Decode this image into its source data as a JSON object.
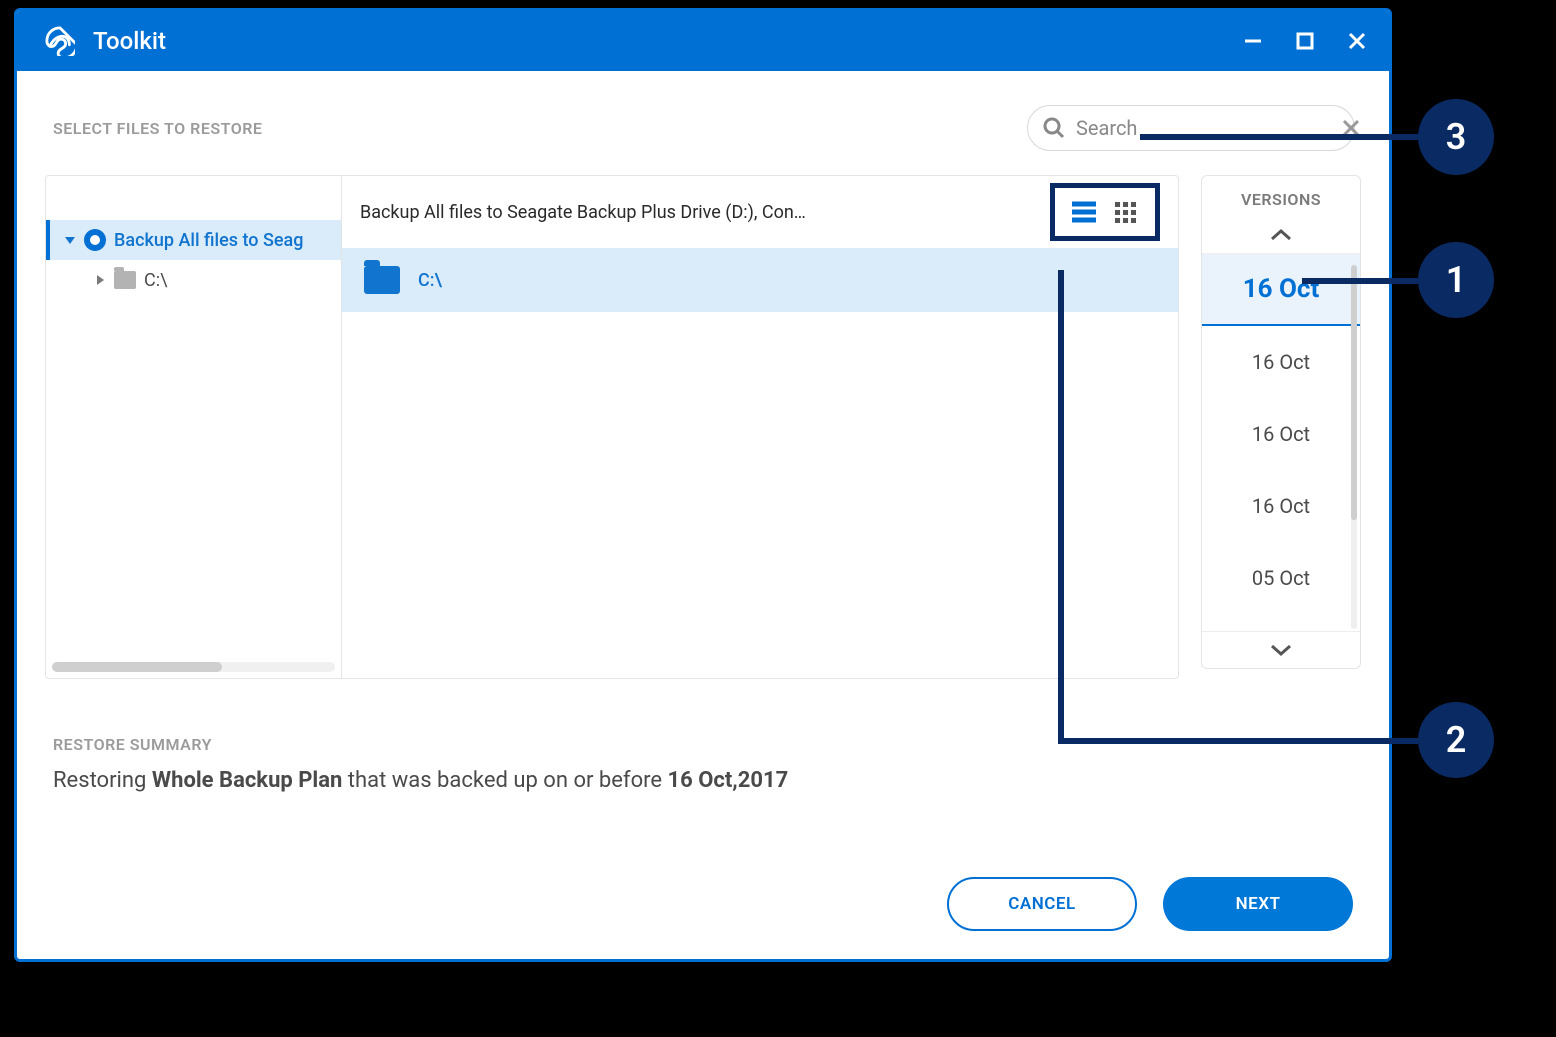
{
  "app": {
    "title": "Toolkit"
  },
  "header": {
    "section_title": "SELECT FILES TO RESTORE",
    "search_placeholder": "Search"
  },
  "tree": {
    "items": [
      {
        "label": "Backup All files to Seag",
        "expanded": true,
        "kind": "plan"
      },
      {
        "label": "C:\\",
        "expanded": false,
        "kind": "drive"
      }
    ]
  },
  "list": {
    "breadcrumb": "Backup All files to Seagate Backup Plus Drive (D:), Con…",
    "rows": [
      {
        "label": "C:\\"
      }
    ]
  },
  "versions": {
    "title": "VERSIONS",
    "items": [
      "16 Oct",
      "16 Oct",
      "16 Oct",
      "16 Oct",
      "05 Oct"
    ],
    "selected_index": 0
  },
  "summary": {
    "title": "RESTORE SUMMARY",
    "prefix": "Restoring ",
    "bold1": "Whole Backup Plan",
    "middle": " that was backed up on or before ",
    "bold2": "16 Oct,2017"
  },
  "buttons": {
    "cancel": "CANCEL",
    "next": "NEXT"
  },
  "callouts": {
    "c1": "1",
    "c2": "2",
    "c3": "3"
  }
}
